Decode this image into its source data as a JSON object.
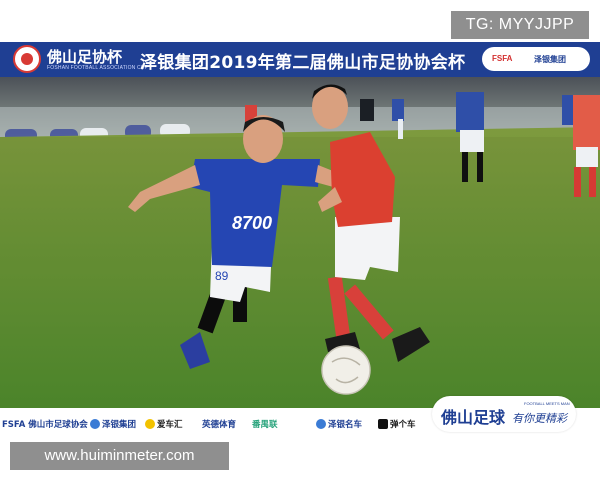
{
  "watermark_top": "TG: MYYJJPP",
  "banner": {
    "association": "佛山足协杯",
    "association_en": "FOSHAN FOOTBALL ASSOCIATION CUP",
    "title": "泽银集团2019年第二届佛山市足协协会杯",
    "sponsor_1": "FSFA",
    "sponsor_2": "泽银集团"
  },
  "photo": {
    "player_blue_shirt_text": "8700",
    "player_blue_number": "89"
  },
  "footer_sponsors": [
    "FSFA 佛山市足球协会",
    "泽银集团",
    "爱车汇",
    "英德体育",
    "番禺联",
    "泽银名车",
    "弹个车"
  ],
  "slogan": {
    "main": "佛山足球",
    "tagline": "有你更精彩",
    "small": "FOOTBALL MEETS MAN"
  },
  "watermark_bottom": "www.huiminmeter.com",
  "colors": {
    "banner_blue": "#1f3f93",
    "accent_red": "#d83a35",
    "watermark_gray": "#8f8f8f"
  }
}
